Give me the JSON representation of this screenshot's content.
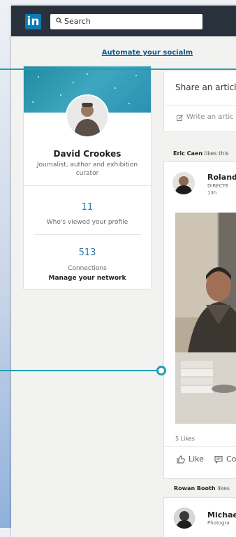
{
  "header": {
    "logo_text": "in",
    "search_placeholder": "Search"
  },
  "promo": {
    "text": "Automate your socialm"
  },
  "profile": {
    "name": "David Crookes",
    "headline": "Journalist, author and exhibition curator",
    "views_count": "11",
    "views_label": "Who's viewed your profile",
    "connections_count": "513",
    "connections_label": "Connections",
    "manage_label": "Manage your network"
  },
  "share": {
    "title": "Share an articl",
    "write_label": "Write an artic"
  },
  "feed": {
    "item1": {
      "actor": "Eric Caen",
      "activity": "likes this",
      "poster_name": "Roland",
      "poster_subtitle": "DIRECTE",
      "time": "13h",
      "likes": "5 Likes",
      "like_label": "Like",
      "comment_label": "Co"
    },
    "item2": {
      "actor": "Rowan Booth",
      "activity": "likes",
      "poster_name": "Michae",
      "poster_subtitle": "Photogra"
    }
  },
  "colors": {
    "brand": "#0a7bb5",
    "topbar": "#29323c",
    "link": "#2f78a8",
    "callout": "#1d9fb3"
  },
  "icons": [
    "search-icon",
    "pencil-icon",
    "thumbs-up-icon",
    "comment-icon"
  ]
}
